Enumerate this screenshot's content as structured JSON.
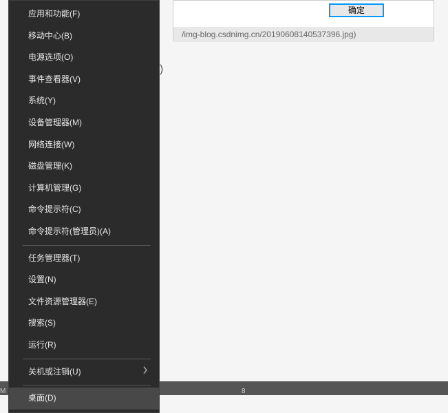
{
  "dialog": {
    "ok_label": "确定",
    "url_text": "/img-blog.csdnimg.cn/20190608140537396.jpg)"
  },
  "background": {
    "fragment": ")"
  },
  "bottom_bar": {
    "marker1": "M",
    "marker2": "8"
  },
  "menu": {
    "group1": [
      {
        "label": "应用和功能(F)"
      },
      {
        "label": "移动中心(B)"
      },
      {
        "label": "电源选项(O)"
      },
      {
        "label": "事件查看器(V)"
      },
      {
        "label": "系统(Y)"
      },
      {
        "label": "设备管理器(M)"
      },
      {
        "label": "网络连接(W)"
      },
      {
        "label": "磁盘管理(K)"
      },
      {
        "label": "计算机管理(G)"
      },
      {
        "label": "命令提示符(C)"
      },
      {
        "label": "命令提示符(管理员)(A)"
      }
    ],
    "group2": [
      {
        "label": "任务管理器(T)"
      },
      {
        "label": "设置(N)"
      },
      {
        "label": "文件资源管理器(E)"
      },
      {
        "label": "搜索(S)"
      },
      {
        "label": "运行(R)"
      }
    ],
    "group3": [
      {
        "label": "关机或注销(U)",
        "submenu": true
      }
    ],
    "group4": [
      {
        "label": "桌面(D)",
        "highlighted": true
      }
    ]
  }
}
